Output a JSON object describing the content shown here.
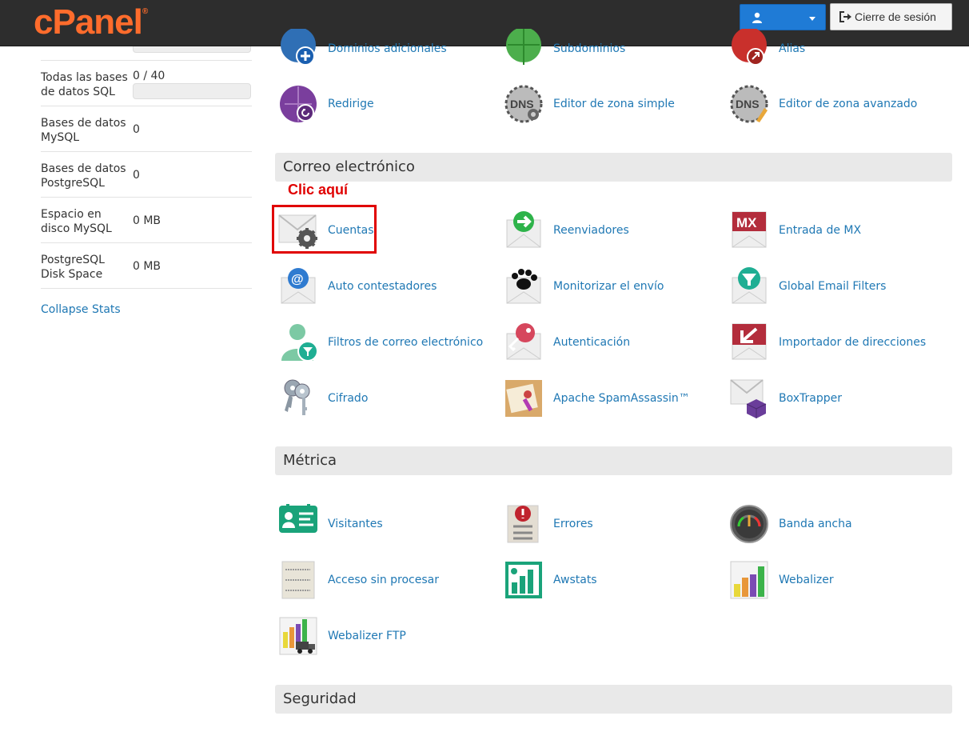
{
  "header": {
    "logo": "cPanel",
    "logo_reg": "®",
    "user_label": "",
    "logout_label": "Cierre de sesión"
  },
  "stats": [
    {
      "label": "Todas las bases de datos SQL",
      "value": "0 / 40",
      "has_bar": true
    },
    {
      "label": "Bases de datos MySQL",
      "value": "0"
    },
    {
      "label": "Bases de datos PostgreSQL",
      "value": "0"
    },
    {
      "label": "Espacio en disco MySQL",
      "value": "0 MB"
    },
    {
      "label": "PostgreSQL Disk Space",
      "value": "0 MB"
    }
  ],
  "collapse_label": "Collapse Stats",
  "annotation": "Clic aquí",
  "domains_partial": [
    {
      "label": "Dominios adicionales",
      "icon": "addon-domains-icon"
    },
    {
      "label": "Subdominios",
      "icon": "subdomains-icon"
    },
    {
      "label": "Alias",
      "icon": "aliases-icon"
    },
    {
      "label": "Redirige",
      "icon": "redirects-icon"
    },
    {
      "label": "Editor de zona simple",
      "icon": "dns-simple-icon"
    },
    {
      "label": "Editor de zona avanzado",
      "icon": "dns-advanced-icon"
    }
  ],
  "sections": {
    "email": {
      "title": "Correo electrónico",
      "items": [
        {
          "label": "Cuentas",
          "icon": "email-accounts-icon"
        },
        {
          "label": "Reenviadores",
          "icon": "forwarders-icon"
        },
        {
          "label": "Entrada de MX",
          "icon": "mx-entry-icon"
        },
        {
          "label": "Auto contestadores",
          "icon": "autoresponders-icon"
        },
        {
          "label": "Monitorizar el envío",
          "icon": "track-delivery-icon"
        },
        {
          "label": "Global Email Filters",
          "icon": "global-filters-icon"
        },
        {
          "label": "Filtros de correo electrónico",
          "icon": "email-filters-icon"
        },
        {
          "label": "Autenticación",
          "icon": "authentication-icon"
        },
        {
          "label": "Importador de direcciones",
          "icon": "address-importer-icon"
        },
        {
          "label": "Cifrado",
          "icon": "encryption-icon"
        },
        {
          "label": "Apache SpamAssassin™",
          "icon": "spamassassin-icon"
        },
        {
          "label": "BoxTrapper",
          "icon": "boxtrapper-icon"
        }
      ]
    },
    "metrics": {
      "title": "Métrica",
      "items": [
        {
          "label": "Visitantes",
          "icon": "visitors-icon"
        },
        {
          "label": "Errores",
          "icon": "errors-icon"
        },
        {
          "label": "Banda ancha",
          "icon": "bandwidth-icon"
        },
        {
          "label": "Acceso sin procesar",
          "icon": "raw-access-icon"
        },
        {
          "label": "Awstats",
          "icon": "awstats-icon"
        },
        {
          "label": "Webalizer",
          "icon": "webalizer-icon"
        },
        {
          "label": "Webalizer FTP",
          "icon": "webalizer-ftp-icon"
        }
      ]
    },
    "security": {
      "title": "Seguridad"
    }
  },
  "colors": {
    "brand_orange": "#ff6c2c",
    "link_blue": "#1f78b4",
    "topbar": "#2d2d2d",
    "annotation_red": "#e00000"
  }
}
